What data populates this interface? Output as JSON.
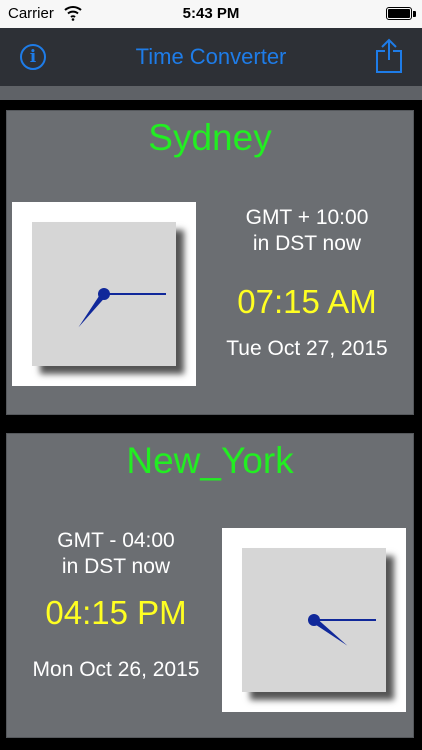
{
  "status_bar": {
    "carrier": "Carrier",
    "time": "5:43 PM",
    "wifi_icon": "wifi-icon",
    "battery_icon": "battery-icon"
  },
  "nav": {
    "title": "Time Converter",
    "info_icon": "info-icon",
    "info_glyph": "i",
    "share_icon": "share-icon"
  },
  "colors": {
    "accent": "#1e7ce8",
    "city": "#22ee22",
    "time": "#ffff22",
    "card_bg": "#6b6e72",
    "nav_bg": "#2d3036"
  },
  "cards": [
    {
      "city": "Sydney",
      "gmt": "GMT + 10:00",
      "dst": "in DST now",
      "time": "07:15 AM",
      "date": "Tue Oct 27, 2015",
      "hour": 7,
      "minute": 15
    },
    {
      "city": "New_York",
      "gmt": "GMT - 04:00",
      "dst": "in DST now",
      "time": "04:15 PM",
      "date": "Mon Oct 26, 2015",
      "hour": 4,
      "minute": 15
    }
  ]
}
